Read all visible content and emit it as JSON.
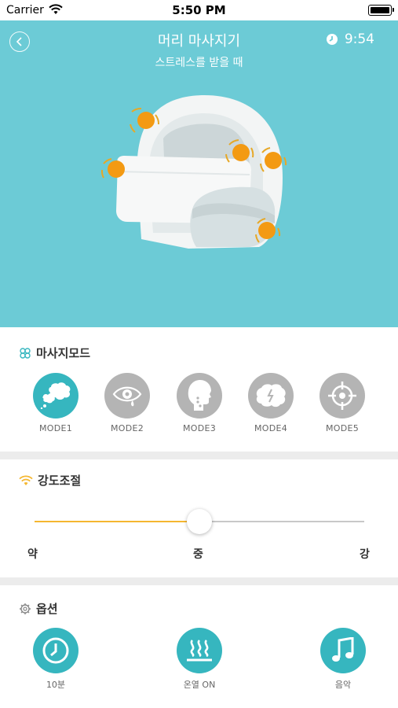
{
  "status_bar": {
    "carrier": "Carrier",
    "time": "5:50 PM"
  },
  "header": {
    "title": "머리 마사지기",
    "subtitle": "스트레스를 받을 때",
    "timer": "9:54"
  },
  "massage_mode": {
    "title": "마사지모드",
    "selected": "MODE1",
    "modes": [
      {
        "label": "MODE1",
        "icon": "speech-bubbles-icon"
      },
      {
        "label": "MODE2",
        "icon": "eye-icon"
      },
      {
        "label": "MODE3",
        "icon": "head-profile-icon"
      },
      {
        "label": "MODE4",
        "icon": "brain-icon"
      },
      {
        "label": "MODE5",
        "icon": "target-icon"
      }
    ]
  },
  "intensity": {
    "title": "강도조절",
    "labels": [
      "약",
      "중",
      "강"
    ],
    "level": 0.5
  },
  "options": {
    "title": "옵션",
    "items": [
      {
        "label": "10분",
        "icon": "clock-icon"
      },
      {
        "label": "온열 ON",
        "icon": "heat-icon"
      },
      {
        "label": "음악",
        "icon": "music-note-icon"
      }
    ]
  },
  "colors": {
    "hero": "#6ccbd6",
    "accent": "#36b6bf",
    "inactive": "#b4b4b4",
    "slider_active": "#f5b730",
    "massage_point": "#f39a13"
  }
}
